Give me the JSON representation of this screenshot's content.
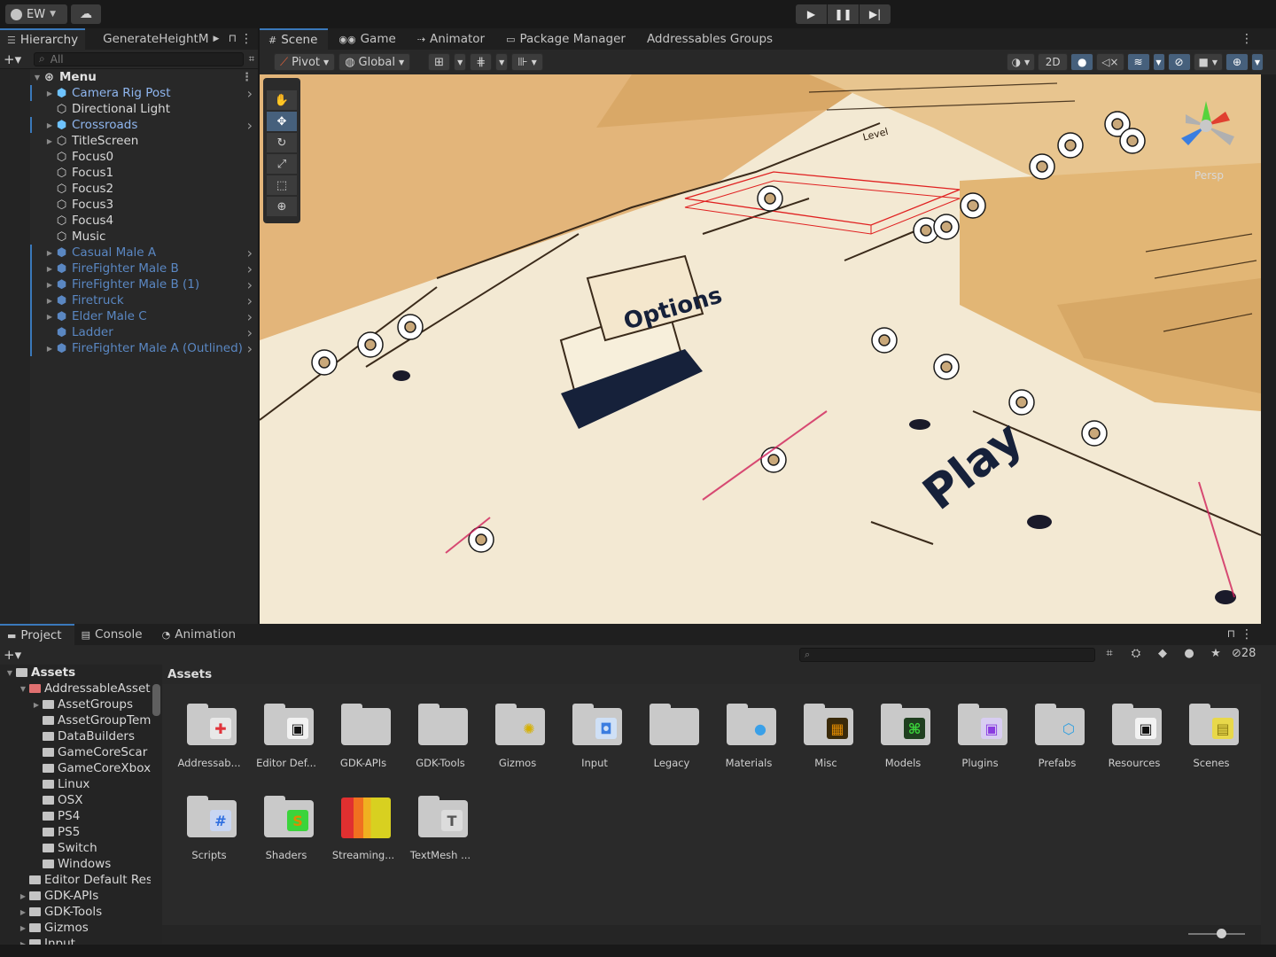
{
  "topbar": {
    "account_label": "EW",
    "play_icons": [
      "play-icon",
      "pause-icon",
      "step-icon"
    ]
  },
  "hierarchy": {
    "tab_label": "Hierarchy",
    "second_tab": "GenerateHeightM",
    "search_placeholder": "All",
    "root": "Menu",
    "items": [
      {
        "label": "Camera Rig Post",
        "style": "prefab",
        "fold": true,
        "arrow": true
      },
      {
        "label": "Directional Light",
        "style": "plain",
        "fold": false,
        "arrow": false
      },
      {
        "label": "Crossroads",
        "style": "prefab",
        "fold": true,
        "arrow": true
      },
      {
        "label": "TitleScreen",
        "style": "plain",
        "fold": true,
        "arrow": false
      },
      {
        "label": "Focus0",
        "style": "plain",
        "fold": false,
        "arrow": false
      },
      {
        "label": "Focus1",
        "style": "plain",
        "fold": false,
        "arrow": false
      },
      {
        "label": "Focus2",
        "style": "plain",
        "fold": false,
        "arrow": false
      },
      {
        "label": "Focus3",
        "style": "plain",
        "fold": false,
        "arrow": false
      },
      {
        "label": "Focus4",
        "style": "plain",
        "fold": false,
        "arrow": false
      },
      {
        "label": "Music",
        "style": "plain",
        "fold": false,
        "arrow": false
      },
      {
        "label": "Casual Male A",
        "style": "prefab-dim",
        "fold": true,
        "arrow": true
      },
      {
        "label": "FireFighter Male B",
        "style": "prefab-dim",
        "fold": true,
        "arrow": true
      },
      {
        "label": "FireFighter Male B (1)",
        "style": "prefab-dim",
        "fold": true,
        "arrow": true
      },
      {
        "label": "Firetruck",
        "style": "prefab-dim",
        "fold": true,
        "arrow": true
      },
      {
        "label": "Elder Male C",
        "style": "prefab-dim",
        "fold": true,
        "arrow": true
      },
      {
        "label": "Ladder",
        "style": "prefab-dim",
        "fold": false,
        "arrow": true
      },
      {
        "label": "FireFighter Male A (Outlined)",
        "style": "prefab-dim",
        "fold": true,
        "arrow": true
      }
    ]
  },
  "scene": {
    "tabs": [
      "Scene",
      "Game",
      "Animator",
      "Package Manager",
      "Addressables Groups"
    ],
    "pivot_label": "Pivot",
    "global_label": "Global",
    "mode_2d": "2D",
    "persp_label": "Persp",
    "world_text": {
      "options": "Options",
      "play": "Play",
      "level": "Level"
    }
  },
  "project": {
    "tabs": [
      "Project",
      "Console",
      "Animation"
    ],
    "hidden_count": "28",
    "tree": [
      {
        "label": "Assets",
        "depth": 0,
        "fold": "open",
        "hdr": true
      },
      {
        "label": "AddressableAsset",
        "depth": 1,
        "fold": "open"
      },
      {
        "label": "AssetGroups",
        "depth": 2,
        "fold": "closed"
      },
      {
        "label": "AssetGroupTem",
        "depth": 2,
        "fold": "none"
      },
      {
        "label": "DataBuilders",
        "depth": 2,
        "fold": "none"
      },
      {
        "label": "GameCoreScar",
        "depth": 2,
        "fold": "none"
      },
      {
        "label": "GameCoreXbox",
        "depth": 2,
        "fold": "none"
      },
      {
        "label": "Linux",
        "depth": 2,
        "fold": "none"
      },
      {
        "label": "OSX",
        "depth": 2,
        "fold": "none"
      },
      {
        "label": "PS4",
        "depth": 2,
        "fold": "none"
      },
      {
        "label": "PS5",
        "depth": 2,
        "fold": "none"
      },
      {
        "label": "Switch",
        "depth": 2,
        "fold": "none"
      },
      {
        "label": "Windows",
        "depth": 2,
        "fold": "none"
      },
      {
        "label": "Editor Default Res",
        "depth": 1,
        "fold": "none"
      },
      {
        "label": "GDK-APIs",
        "depth": 1,
        "fold": "closed"
      },
      {
        "label": "GDK-Tools",
        "depth": 1,
        "fold": "closed"
      },
      {
        "label": "Gizmos",
        "depth": 1,
        "fold": "closed"
      },
      {
        "label": "Input",
        "depth": 1,
        "fold": "closed"
      }
    ],
    "breadcrumb": "Assets",
    "assets": [
      {
        "name": "Addressab...",
        "badge": "✚",
        "color": "#e0343c",
        "bg": "#e8e8e8"
      },
      {
        "name": "Editor Def...",
        "badge": "▣",
        "color": "#111111",
        "bg": "#f2f2f2"
      },
      {
        "name": "GDK-APIs",
        "badge": "",
        "color": "",
        "bg": ""
      },
      {
        "name": "GDK-Tools",
        "badge": "",
        "color": "",
        "bg": ""
      },
      {
        "name": "Gizmos",
        "badge": "✺",
        "color": "#d6b000",
        "bg": "#c9c9c9"
      },
      {
        "name": "Input",
        "badge": "◘",
        "color": "#3b7de0",
        "bg": "#cfe0f6"
      },
      {
        "name": "Legacy",
        "badge": "",
        "color": "",
        "bg": ""
      },
      {
        "name": "Materials",
        "badge": "●",
        "color": "#3aa0e8",
        "bg": "#c9c9c9"
      },
      {
        "name": "Misc",
        "badge": "▦",
        "color": "#e08a00",
        "bg": "#3a2a0a"
      },
      {
        "name": "Models",
        "badge": "⌘",
        "color": "#3bd43b",
        "bg": "#1f3f1f"
      },
      {
        "name": "Plugins",
        "badge": "▣",
        "color": "#8a3ce0",
        "bg": "#d8cdf2"
      },
      {
        "name": "Prefabs",
        "badge": "⬡",
        "color": "#2f9fe0",
        "bg": "#c9c9c9"
      },
      {
        "name": "Resources",
        "badge": "▣",
        "color": "#111111",
        "bg": "#f2f2f2"
      },
      {
        "name": "Scenes",
        "badge": "▤",
        "color": "#8a7a10",
        "bg": "#e8d84a"
      },
      {
        "name": "Scripts",
        "badge": "#",
        "color": "#2f6fe0",
        "bg": "#c9d6f2"
      },
      {
        "name": "Shaders",
        "badge": "S",
        "color": "#e08a00",
        "bg": "#3bd43b"
      },
      {
        "name": "Streaming...",
        "badge": "",
        "color": "",
        "bg": "",
        "streaming": true
      },
      {
        "name": "TextMesh ...",
        "badge": "T",
        "color": "#555555",
        "bg": "#dcdcdc"
      }
    ]
  }
}
